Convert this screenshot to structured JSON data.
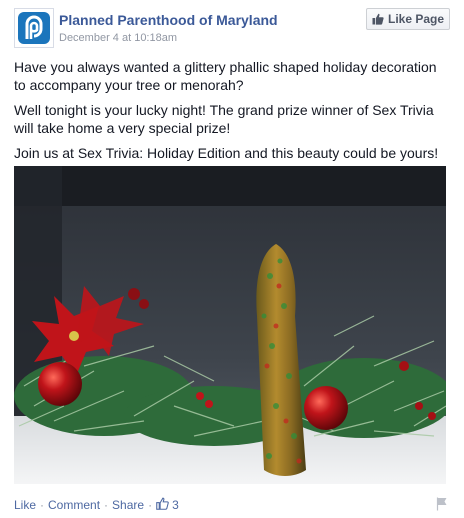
{
  "post": {
    "page_name": "Planned Parenthood of Maryland",
    "timestamp": "December 4 at 10:18am",
    "like_page_label": "Like Page",
    "paragraphs": [
      "Have you always wanted a glittery phallic shaped holiday decoration to accompany your tree or menorah?",
      "Well tonight is your lucky night! The grand prize winner of Sex Trivia will take home a very special prize!",
      "Join us at Sex Trivia: Holiday Edition and this beauty could be yours!"
    ],
    "photo_icon": "holiday-photo",
    "footer": {
      "like_label": "Like",
      "comment_label": "Comment",
      "share_label": "Share",
      "separator": "·",
      "like_count": "3"
    }
  },
  "colors": {
    "brand_blue": "#3b5998",
    "link_blue": "#4e69a2",
    "muted_text": "#9197a3",
    "logo_blue": "#1b75bc"
  },
  "icons": [
    "planned-parenthood-logo-icon",
    "thumbs-up-icon",
    "flag-icon"
  ]
}
